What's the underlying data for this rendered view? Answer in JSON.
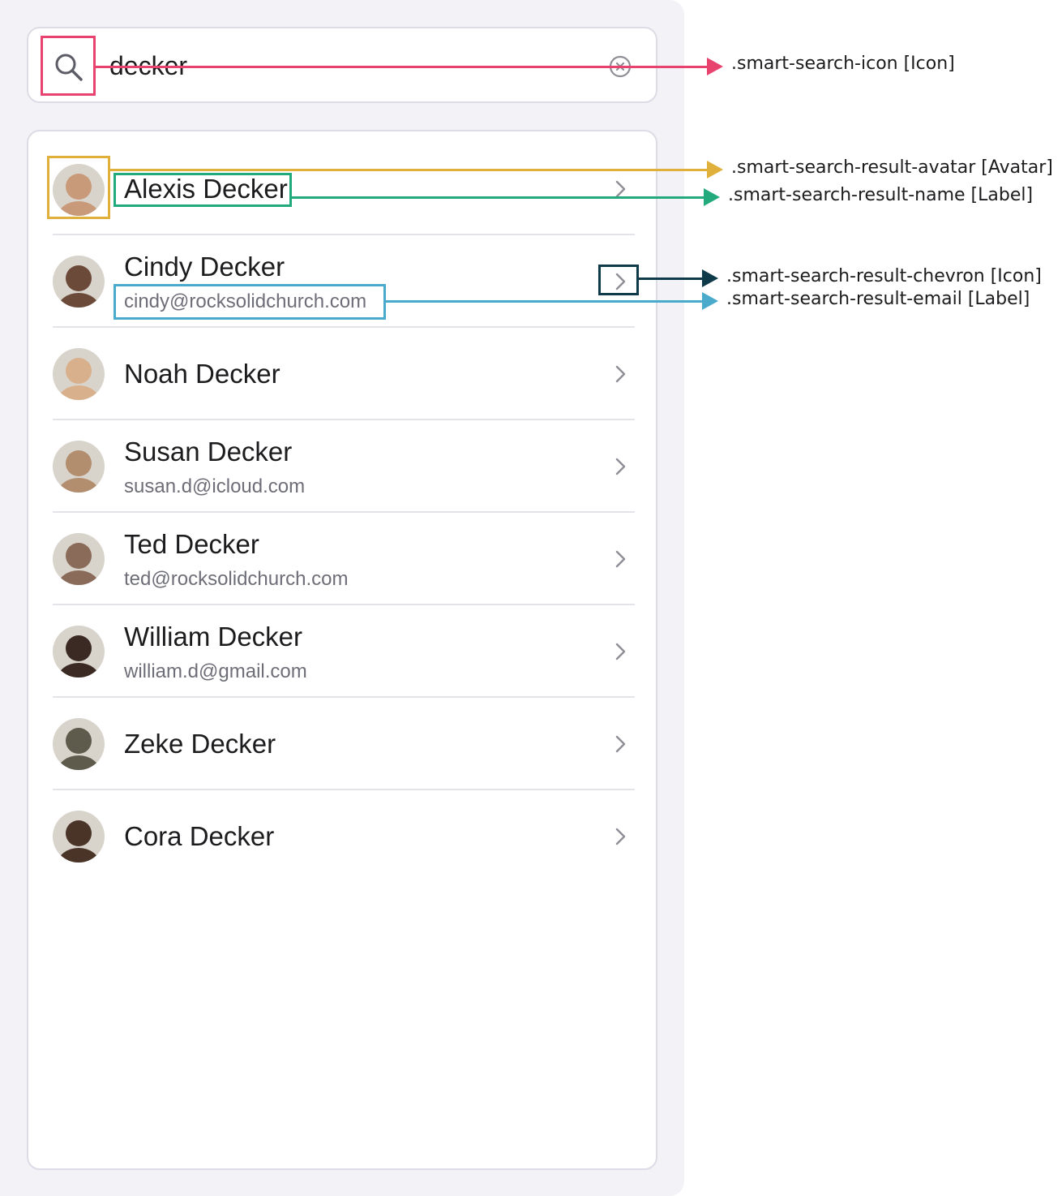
{
  "search": {
    "value": "decker",
    "placeholder": "",
    "icon": "search-icon",
    "clear_icon": "clear-circle-icon"
  },
  "results": [
    {
      "name": "Alexis Decker",
      "email": "",
      "avatar_tone": "#c99a7a"
    },
    {
      "name": "Cindy Decker",
      "email": "cindy@rocksolidchurch.com",
      "avatar_tone": "#6b4a3a"
    },
    {
      "name": "Noah Decker",
      "email": "",
      "avatar_tone": "#d9b08c"
    },
    {
      "name": "Susan Decker",
      "email": "susan.d@icloud.com",
      "avatar_tone": "#b28d6e"
    },
    {
      "name": "Ted Decker",
      "email": "ted@rocksolidchurch.com",
      "avatar_tone": "#8a6a58"
    },
    {
      "name": "William Decker",
      "email": "william.d@gmail.com",
      "avatar_tone": "#3b2a24"
    },
    {
      "name": "Zeke Decker",
      "email": "",
      "avatar_tone": "#5e5a4c"
    },
    {
      "name": "Cora Decker",
      "email": "",
      "avatar_tone": "#4a3428"
    }
  ],
  "annotations": [
    {
      "label": ".smart-search-icon [Icon]",
      "color": "#e8436f"
    },
    {
      "label": ".smart-search-result-avatar [Avatar]",
      "color": "#e0b03c"
    },
    {
      "label": ".smart-search-result-name [Label]",
      "color": "#22a97c"
    },
    {
      "label": ".smart-search-result-chevron [Icon]",
      "color": "#0f3a4a"
    },
    {
      "label": ".smart-search-result-email [Label]",
      "color": "#49aacc"
    }
  ]
}
